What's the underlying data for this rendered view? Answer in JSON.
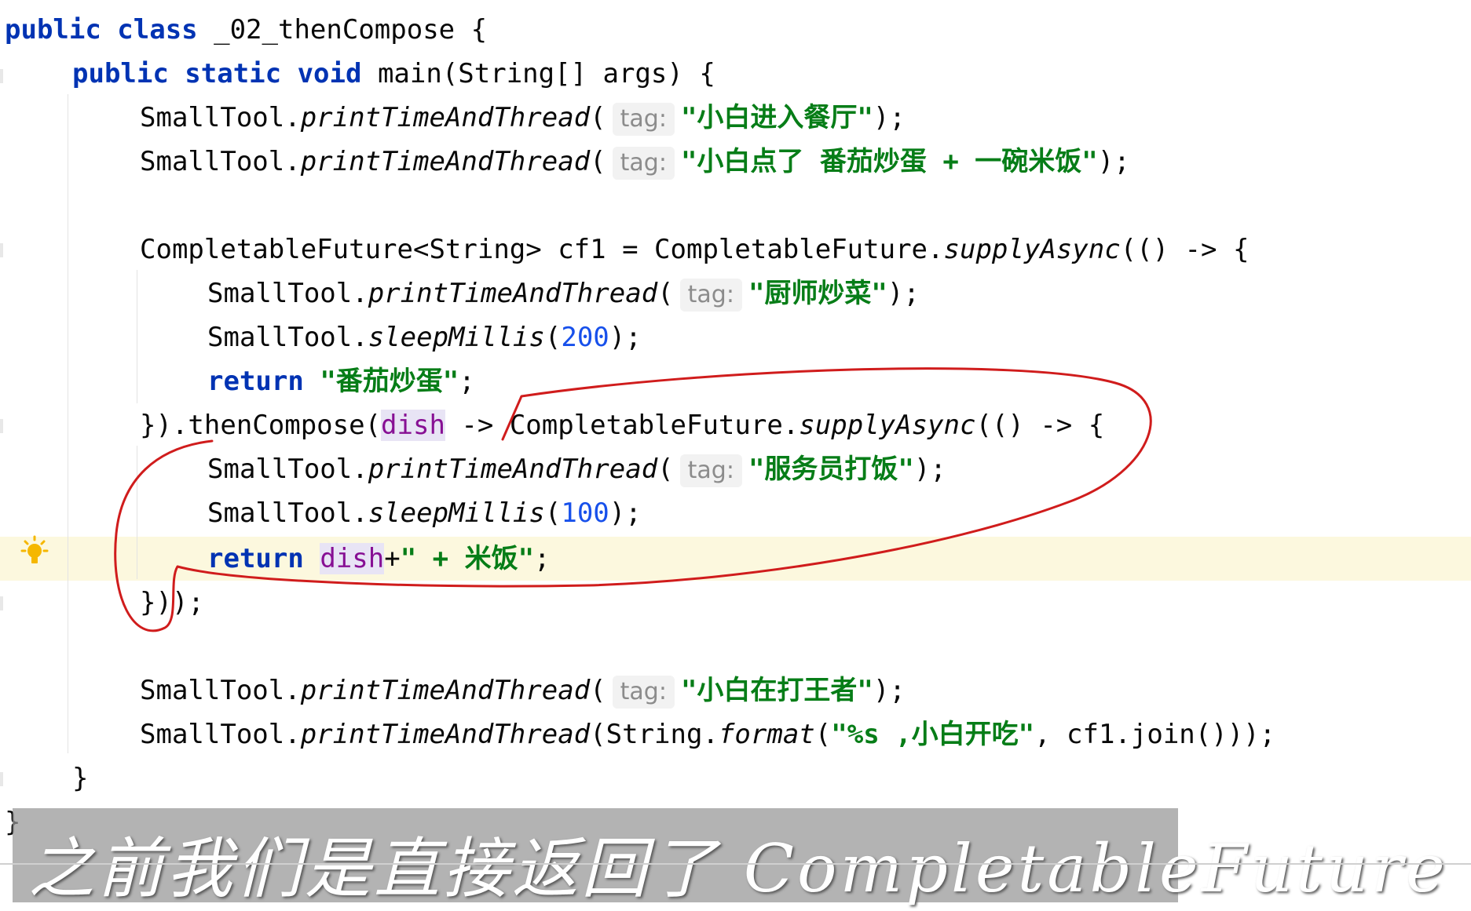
{
  "code": {
    "l1": {
      "kw": "public class",
      "rest": " _02_thenCompose {"
    },
    "l2": {
      "kw": "public static void",
      "rest": " main(String[] args) {"
    },
    "l3": {
      "cls": "SmallTool.",
      "method": "printTimeAndThread",
      "open": "(",
      "hint": "tag:",
      "str": "\"小白进入餐厅\"",
      "close": ");"
    },
    "l4": {
      "cls": "SmallTool.",
      "method": "printTimeAndThread",
      "open": "(",
      "hint": "tag:",
      "str": "\"小白点了 番茄炒蛋 + 一碗米饭\"",
      "close": ");"
    },
    "l5": {
      "pre": "CompletableFuture<String> cf1 = CompletableFuture.",
      "method": "supplyAsync",
      "post": "(() -> {"
    },
    "l6": {
      "cls": "SmallTool.",
      "method": "printTimeAndThread",
      "open": "(",
      "hint": "tag:",
      "str": "\"厨师炒菜\"",
      "close": ");"
    },
    "l7": {
      "cls": "SmallTool.",
      "method": "sleepMillis",
      "open": "(",
      "num": "200",
      "close": ");"
    },
    "l8": {
      "kw": "return",
      "str": "\"番茄炒蛋\"",
      "close": ";"
    },
    "l9": {
      "pre": "}).thenCompose(",
      "dish": "dish",
      "mid": " -> CompletableFuture.",
      "method": "supplyAsync",
      "post": "(() -> {"
    },
    "l10": {
      "cls": "SmallTool.",
      "method": "printTimeAndThread",
      "open": "(",
      "hint": "tag:",
      "str": "\"服务员打饭\"",
      "close": ");"
    },
    "l11": {
      "cls": "SmallTool.",
      "method": "sleepMillis",
      "open": "(",
      "num": "100",
      "close": ");"
    },
    "l12": {
      "kw": "return",
      "dish": "dish",
      "plus": "+",
      "str": "\" + 米饭\"",
      "close": ";"
    },
    "l13": {
      "text": "}));"
    },
    "l14": {
      "cls": "SmallTool.",
      "method": "printTimeAndThread",
      "open": "(",
      "hint": "tag:",
      "str": "\"小白在打王者\"",
      "close": ");"
    },
    "l15": {
      "cls": "SmallTool.",
      "method": "printTimeAndThread",
      "open": "(String.",
      "method2": "format",
      "open2": "(",
      "str": "\"%s ,小白开吃\"",
      "close": ", cf1.join()));"
    },
    "l16": {
      "text": "}"
    },
    "l17": {
      "text": "}"
    }
  },
  "subtitle": "之前我们是直接返回了 CompletableFuture",
  "colors": {
    "keyword": "#0033b3",
    "string": "#067d17",
    "number": "#1750eb",
    "annotation": "#d01c1c",
    "highlight_line": "#fcf8de"
  },
  "icons": {
    "gutter": "lightbulb-icon"
  }
}
